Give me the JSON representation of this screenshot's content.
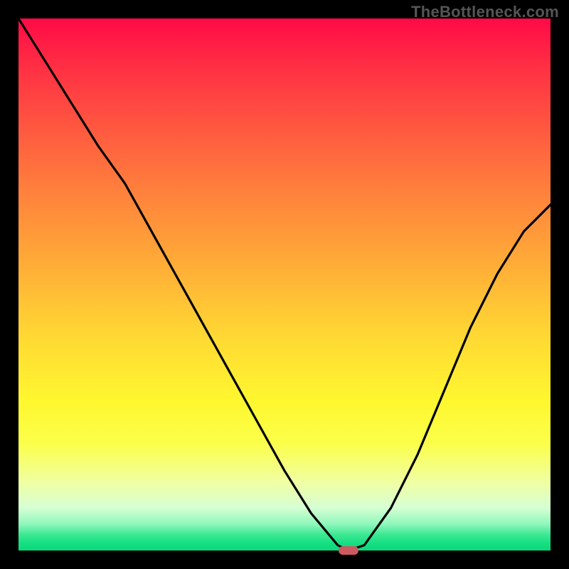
{
  "watermark": "TheBottleneck.com",
  "colors": {
    "frame_border": "#000000",
    "curve_stroke": "#000000",
    "marker_fill": "#cc5a5f",
    "gradient_top": "#ff0a46",
    "gradient_bottom": "#09d87a"
  },
  "chart_data": {
    "type": "line",
    "title": "",
    "xlabel": "",
    "ylabel": "",
    "xlim": [
      0,
      100
    ],
    "ylim": [
      0,
      100
    ],
    "grid": false,
    "series": [
      {
        "name": "bottleneck-curve",
        "x": [
          0,
          5,
          10,
          15,
          20,
          25,
          30,
          35,
          40,
          45,
          50,
          55,
          60,
          62,
          65,
          70,
          75,
          80,
          85,
          90,
          95,
          100
        ],
        "values": [
          100,
          92,
          84,
          76,
          69,
          60,
          51,
          42,
          33,
          24,
          15,
          7,
          1,
          0,
          1,
          8,
          18,
          30,
          42,
          52,
          60,
          65
        ]
      }
    ],
    "marker": {
      "x": 62,
      "y": 0,
      "name": "optimal-point"
    }
  }
}
